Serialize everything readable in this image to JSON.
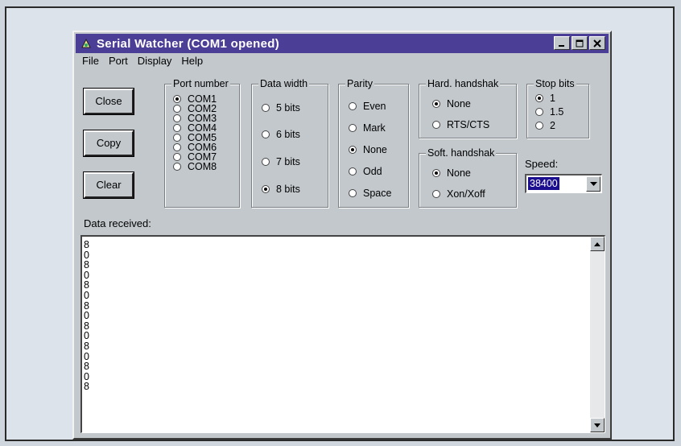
{
  "window": {
    "title": "Serial Watcher (COM1 opened)"
  },
  "menu": [
    "File",
    "Port",
    "Display",
    "Help"
  ],
  "buttons": {
    "close": "Close",
    "copy": "Copy",
    "clear": "Clear"
  },
  "port_number": {
    "title": "Port number",
    "options": [
      "COM1",
      "COM2",
      "COM3",
      "COM4",
      "COM5",
      "COM6",
      "COM7",
      "COM8"
    ],
    "selected": "COM1"
  },
  "data_width": {
    "title": "Data width",
    "options": [
      "5 bits",
      "6 bits",
      "7 bits",
      "8 bits"
    ],
    "selected": "8 bits"
  },
  "parity": {
    "title": "Parity",
    "options": [
      "Even",
      "Mark",
      "None",
      "Odd",
      "Space"
    ],
    "selected": "None"
  },
  "hard_handshake": {
    "title": "Hard. handshak",
    "options": [
      "None",
      "RTS/CTS"
    ],
    "selected": "None"
  },
  "soft_handshake": {
    "title": "Soft. handshak",
    "options": [
      "None",
      "Xon/Xoff"
    ],
    "selected": "None"
  },
  "stop_bits": {
    "title": "Stop bits",
    "options": [
      "1",
      "1.5",
      "2"
    ],
    "selected": "1"
  },
  "speed": {
    "label": "Speed:",
    "value": "38400"
  },
  "data_received": {
    "label": "Data received:",
    "lines": [
      "8",
      "0",
      "8",
      "0",
      "8",
      "0",
      "8",
      "0",
      "8",
      "0",
      "8",
      "0",
      "8",
      "0",
      "8"
    ]
  }
}
